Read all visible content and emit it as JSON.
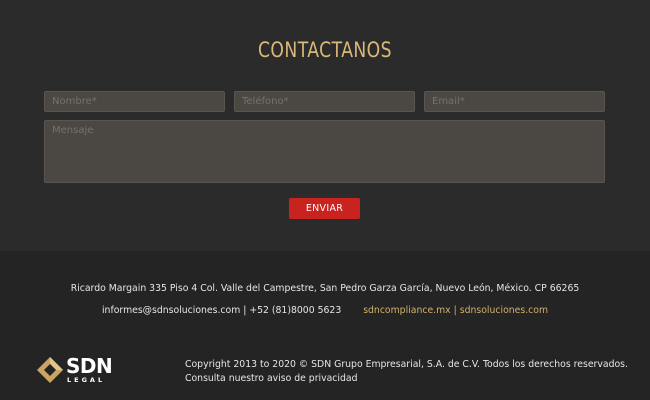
{
  "contact": {
    "title": "CONTACTANOS",
    "name_placeholder": "Nombre*",
    "phone_placeholder": "Teléfono*",
    "email_placeholder": "Email*",
    "message_placeholder": "Mensaje",
    "send_label": "ENVIAR"
  },
  "footer": {
    "address": "Ricardo Margain 335 Piso 4 Col. Valle del Campestre, San Pedro Garza García, Nuevo León, México. CP 66265",
    "contact_info": "informes@sdnsoluciones.com | +52 (81)8000 5623",
    "link_compliance": "sdncompliance.mx",
    "link_separator": " | ",
    "link_soluciones": "sdnsoluciones.com",
    "logo_text": "SDN",
    "logo_subtext": "LEGAL",
    "copyright": "Copyright 2013 to 2020 © SDN Grupo Empresarial, S.A. de C.V. Todos los derechos reservados.",
    "privacy_link": "Consulta nuestro aviso de privacidad"
  },
  "colors": {
    "accent_gold": "#d9b978",
    "button_red": "#c8231f",
    "background": "#2b2b2b",
    "footer_background": "#242424"
  }
}
